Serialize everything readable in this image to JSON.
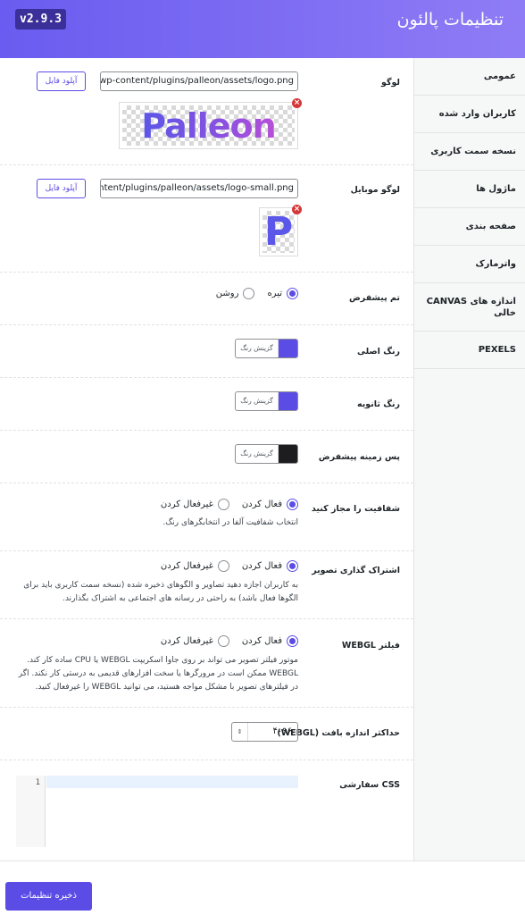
{
  "header": {
    "title": "تنظیمات پالئون",
    "version": "v2.9.3"
  },
  "sidebar": {
    "items": [
      {
        "label": "عمومی"
      },
      {
        "label": "کاربران وارد شده"
      },
      {
        "label": "نسخه سمت کاربری"
      },
      {
        "label": "ماژول ها"
      },
      {
        "label": "صفحه بندی"
      },
      {
        "label": "واترمارک"
      },
      {
        "label": "اندازه های CANVAS خالی"
      },
      {
        "label": "PEXELS"
      }
    ]
  },
  "fields": {
    "logo": {
      "label": "لوگو",
      "value": "/wp-content/plugins/palleon/assets/logo.png",
      "visible_value": "l/wp-content/plugins/palleon/assets/logo.png",
      "upload_label": "آپلود فایل",
      "preview_text": "Palleon"
    },
    "mobile_logo": {
      "label": "لوگو موبایل",
      "visible_value": "content/plugins/palleon/assets/logo-small.png",
      "upload_label": "آپلود فایل",
      "preview_text": "P"
    },
    "default_theme": {
      "label": "تم پیشفرض",
      "options": [
        "تیره",
        "روشن"
      ],
      "selected": "تیره"
    },
    "primary_color": {
      "label": "رنگ اصلی",
      "picker_label": "گزینش رنگ",
      "color": "#5b4ce6"
    },
    "secondary_color": {
      "label": "رنگ ثانویه",
      "picker_label": "گزینش رنگ",
      "color": "#5b4ce6"
    },
    "default_background": {
      "label": "پس زمینه پیشفرض",
      "picker_label": "گزینش رنگ",
      "color": "#1d1d1f"
    },
    "allow_transparency": {
      "label": "شفافیت را مجاز کنید",
      "options": [
        "فعال کردن",
        "غیرفعال کردن"
      ],
      "selected": "فعال کردن",
      "description": "انتخاب شفافیت آلفا در انتخابگرهای رنگ."
    },
    "image_sharing": {
      "label": "اشتراک گذاری تصویر",
      "options": [
        "فعال کردن",
        "غیرفعال کردن"
      ],
      "selected": "فعال کردن",
      "description": "به کاربران اجازه دهید تصاویر و الگوهای ذخیره شده (نسخه سمت کاربری باید برای الگوها فعال باشد) به راحتی در رسانه های اجتماعی به اشتراک بگذارند."
    },
    "webgl_filter": {
      "label": "فیلتر WEBGL",
      "options": [
        "فعال کردن",
        "غیرفعال کردن"
      ],
      "selected": "فعال کردن",
      "description": "موتور فیلتر تصویر می تواند بر روی جاوا اسکریپت WEBGL یا CPU ساده کار کند. WEBGL ممکن است در مرورگرها یا سخت افزارهای قدیمی به درستی کار نکند. اگر در فیلترهای تصویر با مشکل مواجه هستید، می توانید WEBGL را غیرفعال کنید."
    },
    "max_texture_size": {
      "label": "حداکثر اندازه بافت (WEBGL)",
      "value": "۴۰۹۶",
      "spin_symbol": "⇕"
    },
    "custom_css": {
      "label": "CSS سفارشی",
      "line_number": "1",
      "content": ""
    }
  },
  "footer": {
    "save_label": "ذخیره تنظیمات"
  },
  "icons": {
    "remove": "×"
  }
}
